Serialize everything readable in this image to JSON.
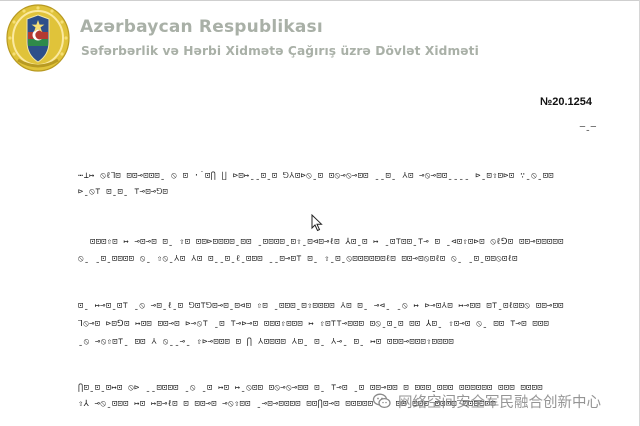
{
  "header": {
    "organization": "Azərbaycan Respublikası",
    "service": "Səfərbərlik və Hərbi Xidmətə Çağırış üzrə Dövlət Xidməti"
  },
  "document": {
    "number": "№20.1254",
    "number_mark": "–ˍ–",
    "paragraphs": [
      [
        "⋯⊥↦ ⦸ℓ⅂⊡ ⊡⊡⊸⊡⊡⊡ˍ ⦸ ⊡ ·˙⊡⋂ ∐ ⊳⊡↦ˍˍ⊡ˍ⊡ ⅁⅄⊡⊳⦸ˍ⊡ ⊡⦸⊸⦸⊸⊡⊡ ˍˍ⊡ˍ ⅄⊡ ⊸⦸⊸⊡⊡ˍˍˍˍ ⊳ˍ⊡⇧⊡⊳⊡ ∵ˍ⦸ˍ⊡⊡",
        "⊳ˍ⦸⊤ ⊡ˍ⊡ˍ ⊤⊸⊡⊸⅁⊡"
      ],
      [
        "⊡⊡⊡⇧⊡ ↦ ⊸⊡⊸⊡ ⊡ˍ ⇧⊡ ⊡⊡⊳⊡⊡⊡⊡ˍ⊡⊡ ˍ⊡⊡⊡⊡ˍ⊡⇧ˍ⊡⊲⊡⊸ℓ⊡ ⅄⊡ˍ⊡ ↦ ˍ⊡⊤⊡⊡ˍ⊤⊸ ⊡ ˍ⊲⊡⇧⊡⊳⊡ ⦸ℓ⅁⊡ ⊡⊡⊸⊡⊡⊡⊡⊡",
        "⦸ˍ ˍ⊡ˍ⊡⊡⊡⊡ ⦸ˍ ⇧⦸ˍ⅄⊡ ⅄⊡ ⊡ˍˍ⊡ˍℓˍ⊡⊡⊡ ˍˍ⊡⊸⊡⊤ ⊡ˍ ⇧ˍ⊡ˍ⦸⊡⊡⊡⊡⊡⊡ℓ⊡ ⊡⊡⊸⊡⦸⊡ℓ⊡ ⦸ˍ ˍ⊡ˍ⊡⊡⦸⊡ℓ⊡"
      ],
      [
        "⊡ˍ ↦⊸⊡ˍ⊡⊤ ˍ⦸ ⊸⊡ˍℓˍ⊡ ⅁⊡⊤⅁⊡⊸⊡ˍ⊡⊲⊡ ⇧⊡ ˍ⊡⊡⊡ˍ⊡⇧⊡⊡⊡⊡ ⅄⊡ ⊡ˍ ⊸⊲ˍ ˍ⦸ ↦ ⊳⊸⊡⅄⊡ ↦⊸⊡⊡ ⊡⊤ˍ⊡ℓ⊡⊡⦸ ⊡⊡⊸⊡⊡",
        "⅂⦸⊸⊡ ⊳⊡⅁⊡ ↦⊡⊡ ⊡⊡⊸⊡ ⊳⊸⦸⊤ ˍ⊡ ⊤⊸⊳⊸⊡ ⊡⊡⊡⇧⊡⊡⊡ ↦ ⇧⊡⊤⊤⊸⊡⊡⊡ ⊡⦸ˍ⊡ˍ⊡ ⊡⊡ ⅄⊡ˍ ⇧⊡⊸⊡ ⦸ˍ ⊡⊡ ⊤⊸⊡ ⊡⊡⊡",
        "ˍ⦸ ⊸⦸⇧⊡⊤ˍ ⊡⊡ ⅄ ⦸ˍˍ⊸ˍ ⇧⊳⊸⊡⊡⊡ ⊡ ⋂ ⅄⊡⊡⊡⊡ ⅄⊡ˍ ⊡ˍ ⅄⊸ˍ ⊡ˍ ↦⊡ ⊡⊡⊡⊸⊡⊡⊡⇧⊡⊡⊡⊡"
      ],
      [
        "⋂⊡ˍ⊡ˍ⊡↦⊡ ⦸⊳ ˍˍ⊡⊡⊡⊡ ˍ⦸ ˍ⊡ ↦⊡ ↦ˍ⦸⊡⊡ ⊡⦸⊸⦸⊸⊡⊡ ⊡ˍ ⊤⊸⊡ ˍ⊡ ⊡⊡⊸⊡⊡ ⊡ ⊡⊡⊡ˍ⊡⊡⊡ ⊡⊡⊡⊡⊡⊡ ⊡⊡⊡ ⊡⊡⊡⊡",
        "⇧⅄ ⊸⦸ˍ⊡⊡⊡ ↦⊡ ↦⊡⊸ℓ⊡ ⊡ ⊡⊡⊸⊡ ⊸⦸⇧⊡⊡ ˍ⊸⊡⊸⊡⊡⊡⊡ ⊡⊡⋂⊡⊸⊡ ⊡⊡⊡⊡⊡ ⊡⊡ ⊡⊡ˍ⊡⊡⊡ ⊡⊡⊡⊡ ⊡⊡⊡⊡⊡⊡"
      ]
    ]
  },
  "watermark": {
    "text": "网络空间安全军民融合创新中心"
  },
  "colors": {
    "header_text": "#a9b0a7",
    "emblem_gold": "#e0c33a",
    "emblem_blue": "#2d4f8a",
    "emblem_red": "#b43a32",
    "emblem_green": "#2f8a4a"
  },
  "icons": [
    "state-emblem",
    "mouse-cursor-icon",
    "wechat-icon"
  ]
}
